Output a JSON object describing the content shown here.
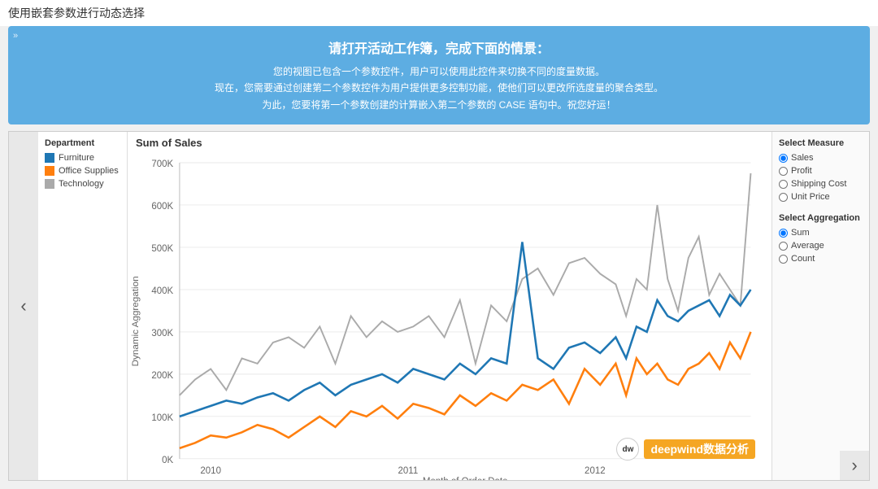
{
  "pageTitle": "使用嵌套参数进行动态选择",
  "instructionBox": {
    "expandIcon": "»",
    "title": "请打开活动工作簿，完成下面的情景：",
    "lines": [
      "您的视图已包含一个参数控件，用户可以使用此控件来切换不同的度量数据。",
      "现在，您需要通过创建第二个参数控件为用户提供更多控制功能，使他们可以更改所选度量的聚合类型。",
      "为此，您要将第一个参数创建的计算嵌入第二个参数的 CASE 语句中。祝您好运！"
    ]
  },
  "navArrowLeft": "‹",
  "navArrowRight": "›",
  "legend": {
    "title": "Department",
    "items": [
      {
        "label": "Furniture",
        "color": "#1f77b4"
      },
      {
        "label": "Office Supplies",
        "color": "#ff7f0e"
      },
      {
        "label": "Technology",
        "color": "#aaa"
      }
    ]
  },
  "chartTitle": "Sum of Sales",
  "yAxisLabel": "Dynamic Aggregation",
  "xAxisLabel": "Month of Order Date",
  "yAxisTicks": [
    "700K",
    "600K",
    "500K",
    "400K",
    "300K",
    "200K",
    "100K",
    "0K"
  ],
  "xAxisTicks": [
    "2010",
    "2011",
    "2012"
  ],
  "rightPanel": {
    "selectMeasureTitle": "Select Measure",
    "measureOptions": [
      {
        "label": "Sales",
        "checked": true
      },
      {
        "label": "Profit",
        "checked": false
      },
      {
        "label": "Shipping Cost",
        "checked": false
      },
      {
        "label": "Unit Price",
        "checked": false
      }
    ],
    "selectAggregationTitle": "Select Aggregation",
    "aggregationOptions": [
      {
        "label": "Sum",
        "checked": true
      },
      {
        "label": "Average",
        "checked": false
      },
      {
        "label": "Count",
        "checked": false
      }
    ]
  },
  "watermark": {
    "logoText": "dw",
    "text": "deepwind数据分析"
  }
}
